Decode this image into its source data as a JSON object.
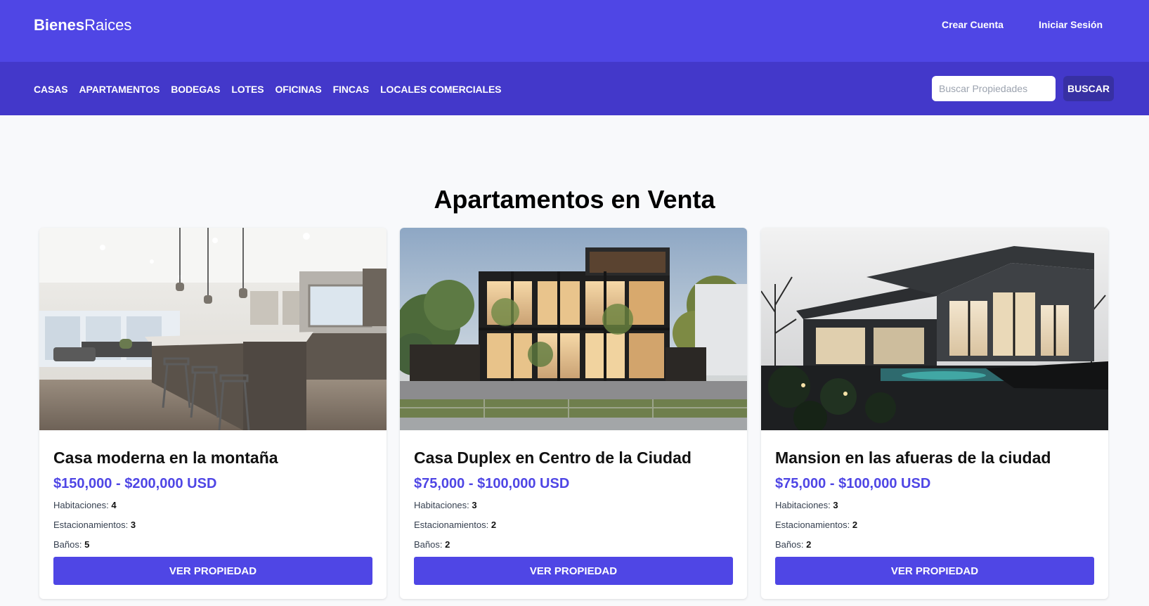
{
  "header": {
    "logo_bold": "Bienes",
    "logo_light": "Raices",
    "create_account": "Crear Cuenta",
    "login": "Iniciar Sesión"
  },
  "nav": {
    "items": [
      "CASAS",
      "APARTAMENTOS",
      "BODEGAS",
      "LOTES",
      "OFICINAS",
      "FINCAS",
      "LOCALES COMERCIALES"
    ],
    "search_placeholder": "Buscar Propiedades",
    "search_button": "BUSCAR"
  },
  "main": {
    "title": "Apartamentos en Venta",
    "attr_labels": {
      "rooms": "Habitaciones:",
      "parking": "Estacionamientos:",
      "baths": "Baños:"
    },
    "button_label": "VER PROPIEDAD",
    "properties": [
      {
        "title": "Casa moderna en la montaña",
        "price": "$150,000 - $200,000 USD",
        "rooms": "4",
        "parking": "3",
        "baths": "5",
        "image": "modern-kitchen-photo"
      },
      {
        "title": "Casa Duplex en Centro de la Ciudad",
        "price": "$75,000 - $100,000 USD",
        "rooms": "3",
        "parking": "2",
        "baths": "2",
        "image": "duplex-house-photo"
      },
      {
        "title": "Mansion en las afueras de la ciudad",
        "price": "$75,000 - $100,000 USD",
        "rooms": "3",
        "parking": "2",
        "baths": "2",
        "image": "night-mansion-photo"
      }
    ]
  },
  "colors": {
    "primary": "#4f46e5",
    "nav_bg": "#4338ca",
    "search_button_bg": "#3730a3",
    "page_bg": "#f8f9fb"
  }
}
